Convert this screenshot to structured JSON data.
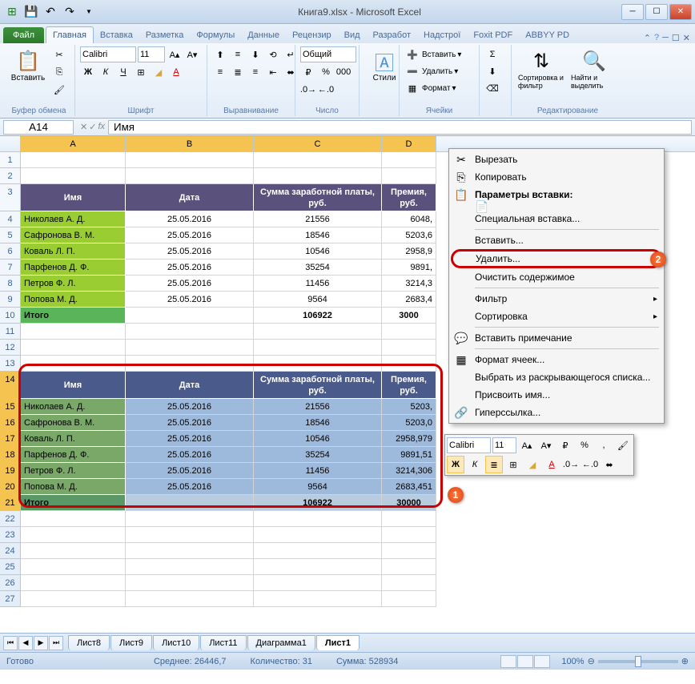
{
  "title": "Книга9.xlsx - Microsoft Excel",
  "tabs": {
    "file": "Файл",
    "home": "Главная",
    "insert": "Вставка",
    "layout": "Разметка",
    "formulas": "Формулы",
    "data": "Данные",
    "review": "Рецензир",
    "view": "Вид",
    "developer": "Разработ",
    "addins": "Надстрої",
    "foxit": "Foxit PDF",
    "abbyy": "ABBYY PD"
  },
  "ribbon": {
    "paste": "Вставить",
    "clipboard": "Буфер обмена",
    "font_label": "Шрифт",
    "align_label": "Выравнивание",
    "number_label": "Число",
    "styles": "Стили",
    "cells_label": "Ячейки",
    "editing": "Редактирование",
    "font": "Calibri",
    "size": "11",
    "format": "Общий",
    "insert_cell": "Вставить",
    "delete_cell": "Удалить",
    "format_cell": "Формат",
    "sort": "Сортировка и фильтр",
    "find": "Найти и выделить"
  },
  "namebox": "A14",
  "formula": "Имя",
  "cols": {
    "A": 131,
    "B": 160,
    "C": 160,
    "D": 68
  },
  "headers": {
    "name": "Имя",
    "date": "Дата",
    "salary": "Сумма заработной платы, руб.",
    "bonus": "Премия, руб."
  },
  "rows": [
    {
      "name": "Николаев А. Д.",
      "date": "25.05.2016",
      "salary": "21556",
      "bonus": "6048,"
    },
    {
      "name": "Сафронова В. М.",
      "date": "25.05.2016",
      "salary": "18546",
      "bonus": "5203,6"
    },
    {
      "name": "Коваль Л. П.",
      "date": "25.05.2016",
      "salary": "10546",
      "bonus": "2958,9"
    },
    {
      "name": "Парфенов Д. Ф.",
      "date": "25.05.2016",
      "salary": "35254",
      "bonus": "9891,"
    },
    {
      "name": "Петров Ф. Л.",
      "date": "25.05.2016",
      "salary": "11456",
      "bonus": "3214,3"
    },
    {
      "name": "Попова М. Д.",
      "date": "25.05.2016",
      "salary": "9564",
      "bonus": "2683,4"
    }
  ],
  "total": {
    "label": "Итого",
    "salary": "106922",
    "bonus": "3000"
  },
  "rows2": [
    {
      "name": "Николаев А. Д.",
      "date": "25.05.2016",
      "salary": "21556",
      "bonus": "5203,"
    },
    {
      "name": "Сафронова В. М.",
      "date": "25.05.2016",
      "salary": "18546",
      "bonus": "5203,0"
    },
    {
      "name": "Коваль Л. П.",
      "date": "25.05.2016",
      "salary": "10546",
      "bonus": "2958,979"
    },
    {
      "name": "Парфенов Д. Ф.",
      "date": "25.05.2016",
      "salary": "35254",
      "bonus": "9891,51"
    },
    {
      "name": "Петров Ф. Л.",
      "date": "25.05.2016",
      "salary": "11456",
      "bonus": "3214,306"
    },
    {
      "name": "Попова М. Д.",
      "date": "25.05.2016",
      "salary": "9564",
      "bonus": "2683,451"
    }
  ],
  "total2": {
    "label": "Итого",
    "salary": "106922",
    "bonus": "30000"
  },
  "ctx": {
    "cut": "Вырезать",
    "copy": "Копировать",
    "paste_opts": "Параметры вставки:",
    "paste_special": "Специальная вставка...",
    "insert": "Вставить...",
    "delete": "Удалить...",
    "clear": "Очистить содержимое",
    "filter": "Фильтр",
    "sort": "Сортировка",
    "comment": "Вставить примечание",
    "format": "Формат ячеек...",
    "dropdown": "Выбрать из раскрывающегося списка...",
    "name": "Присвоить имя...",
    "link": "Гиперссылка..."
  },
  "sheets": {
    "s8": "Лист8",
    "s9": "Лист9",
    "s10": "Лист10",
    "s11": "Лист11",
    "diag": "Диаграмма1",
    "s1": "Лист1"
  },
  "status": {
    "ready": "Готово",
    "avg_lbl": "Среднее:",
    "avg": "26446,7",
    "cnt_lbl": "Количество:",
    "cnt": "31",
    "sum_lbl": "Сумма:",
    "sum": "528934",
    "zoom": "100%"
  },
  "badges": {
    "b1": "1",
    "b2": "2"
  }
}
